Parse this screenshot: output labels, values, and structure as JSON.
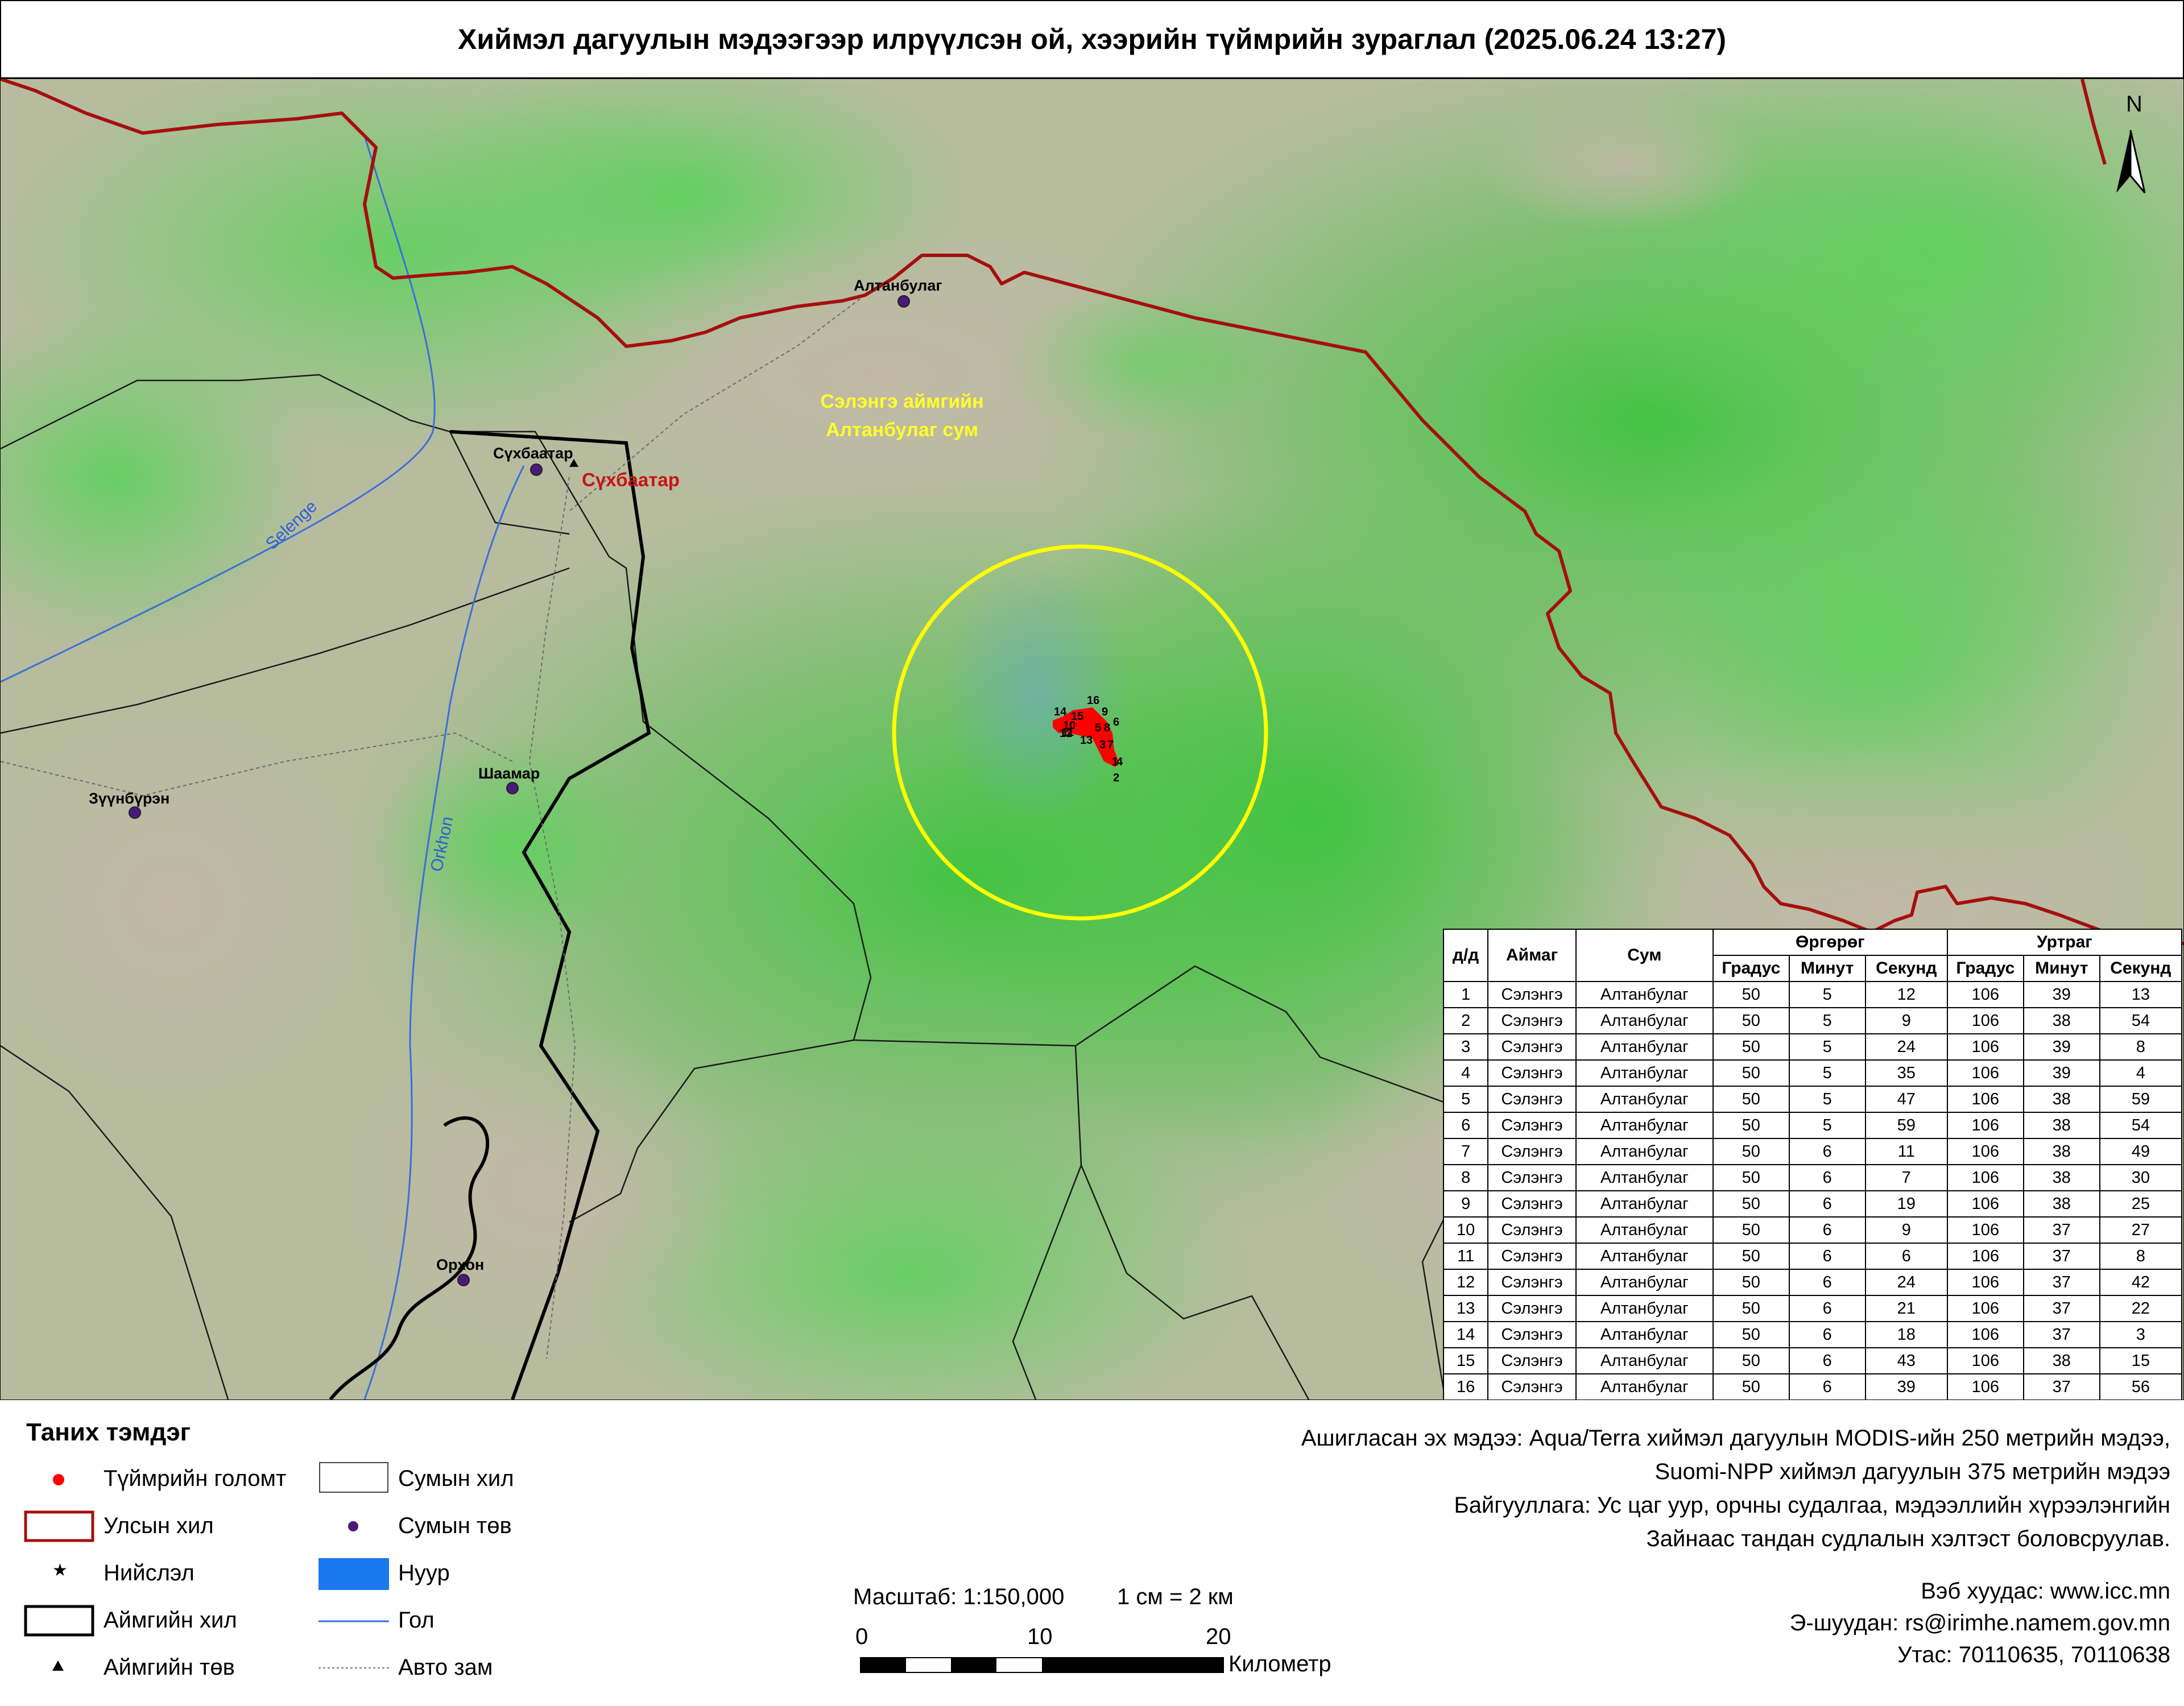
{
  "title": "Хиймэл дагуулын мэдээгээр илрүүлсэн ой, хээрийн түймрийн зураглал (2025.06.24 13:27)",
  "map": {
    "places": [
      {
        "name": "Алтанбулаг"
      },
      {
        "name": "Сүхбаатар"
      },
      {
        "name": "Шаамар"
      },
      {
        "name": "Зүүнбүрэн"
      },
      {
        "name": "Орхон"
      }
    ],
    "province_center_label": "Сүхбаатар",
    "area_label_line1": "Сэлэнгэ аймгийн",
    "area_label_line2": "Алтанбулаг сум",
    "rivers": [
      "Selenge",
      "Orkhon"
    ],
    "north_label": "N",
    "fire_point_labels": [
      "1",
      "2",
      "3",
      "4",
      "5",
      "6",
      "7",
      "8",
      "9",
      "10",
      "11",
      "12",
      "13",
      "14",
      "15",
      "16"
    ],
    "colors": {
      "fire": "#ff0000",
      "national_border": "#a50f0f",
      "province_border": "#000000",
      "river": "#3a70d8",
      "highlight_circle": "#ffff00",
      "forest": "#4fc84f",
      "steppe": "#b6b89e"
    }
  },
  "table": {
    "headers": {
      "num": "д/д",
      "province": "Аймаг",
      "soum": "Сум",
      "latitude": "Өргөрөг",
      "longitude": "Уртраг",
      "deg": "Градус",
      "min": "Минут",
      "sec": "Секунд"
    },
    "rows": [
      [
        "1",
        "Сэлэнгэ",
        "Алтанбулаг",
        "50",
        "5",
        "12",
        "106",
        "39",
        "13"
      ],
      [
        "2",
        "Сэлэнгэ",
        "Алтанбулаг",
        "50",
        "5",
        "9",
        "106",
        "38",
        "54"
      ],
      [
        "3",
        "Сэлэнгэ",
        "Алтанбулаг",
        "50",
        "5",
        "24",
        "106",
        "39",
        "8"
      ],
      [
        "4",
        "Сэлэнгэ",
        "Алтанбулаг",
        "50",
        "5",
        "35",
        "106",
        "39",
        "4"
      ],
      [
        "5",
        "Сэлэнгэ",
        "Алтанбулаг",
        "50",
        "5",
        "47",
        "106",
        "38",
        "59"
      ],
      [
        "6",
        "Сэлэнгэ",
        "Алтанбулаг",
        "50",
        "5",
        "59",
        "106",
        "38",
        "54"
      ],
      [
        "7",
        "Сэлэнгэ",
        "Алтанбулаг",
        "50",
        "6",
        "11",
        "106",
        "38",
        "49"
      ],
      [
        "8",
        "Сэлэнгэ",
        "Алтанбулаг",
        "50",
        "6",
        "7",
        "106",
        "38",
        "30"
      ],
      [
        "9",
        "Сэлэнгэ",
        "Алтанбулаг",
        "50",
        "6",
        "19",
        "106",
        "38",
        "25"
      ],
      [
        "10",
        "Сэлэнгэ",
        "Алтанбулаг",
        "50",
        "6",
        "9",
        "106",
        "37",
        "27"
      ],
      [
        "11",
        "Сэлэнгэ",
        "Алтанбулаг",
        "50",
        "6",
        "6",
        "106",
        "37",
        "8"
      ],
      [
        "12",
        "Сэлэнгэ",
        "Алтанбулаг",
        "50",
        "6",
        "24",
        "106",
        "37",
        "42"
      ],
      [
        "13",
        "Сэлэнгэ",
        "Алтанбулаг",
        "50",
        "6",
        "21",
        "106",
        "37",
        "22"
      ],
      [
        "14",
        "Сэлэнгэ",
        "Алтанбулаг",
        "50",
        "6",
        "18",
        "106",
        "37",
        "3"
      ],
      [
        "15",
        "Сэлэнгэ",
        "Алтанбулаг",
        "50",
        "6",
        "43",
        "106",
        "38",
        "15"
      ],
      [
        "16",
        "Сэлэнгэ",
        "Алтанбулаг",
        "50",
        "6",
        "39",
        "106",
        "37",
        "56"
      ]
    ]
  },
  "legend": {
    "title": "Таних тэмдэг",
    "items": [
      {
        "label": "Түймрийн голомт",
        "icon": "fire-point-icon"
      },
      {
        "label": "Улсын хил",
        "icon": "national-border-icon"
      },
      {
        "label": "Нийслэл",
        "icon": "capital-star-icon"
      },
      {
        "label": "Аймгийн хил",
        "icon": "province-border-icon"
      },
      {
        "label": "Аймгийн төв",
        "icon": "province-center-triangle-icon"
      },
      {
        "label": "Сумын хил",
        "icon": "soum-border-icon"
      },
      {
        "label": "Сумын төв",
        "icon": "soum-center-dot-icon"
      },
      {
        "label": "Нуур",
        "icon": "lake-icon"
      },
      {
        "label": "Гол",
        "icon": "river-line-icon"
      },
      {
        "label": "Авто зам",
        "icon": "road-dashed-icon"
      }
    ]
  },
  "scale": {
    "caption": "Масштаб: 1:150,000",
    "equivalence": "1 см = 2 км",
    "ticks": [
      "0",
      "10",
      "20"
    ],
    "unit": "Километр"
  },
  "source": {
    "line1": "Ашигласан эх мэдээ: Aqua/Terra хиймэл дагуулын MODIS-ийн 250 метрийн мэдээ,",
    "line2": "Suomi-NPP хиймэл дагуулын 375 метрийн мэдээ",
    "line3": "Байгууллага: Ус цаг уур, орчны судалгаа, мэдээллийн хүрээлэнгийн",
    "line4": "Зайнаас тандан судлалын хэлтэст боловсруулав."
  },
  "contact": {
    "web": "Вэб хуудас: www.icc.mn",
    "email": "Э-шуудан: rs@irimhe.namem.gov.mn",
    "phone": "Утас: 70110635, 70110638"
  }
}
